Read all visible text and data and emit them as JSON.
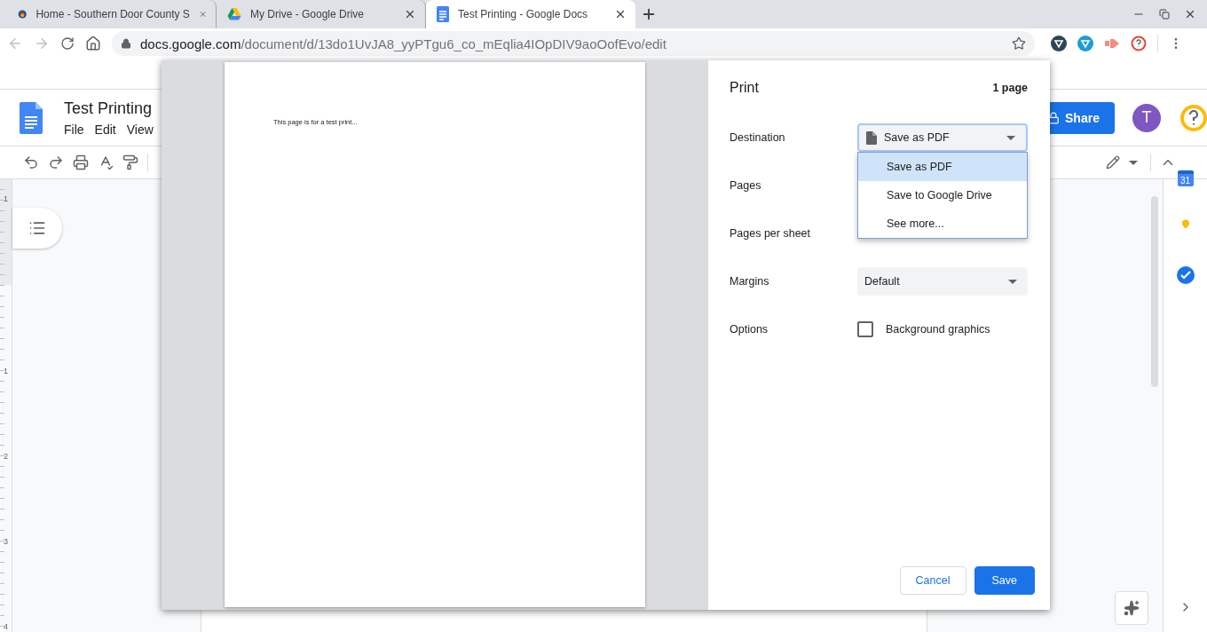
{
  "browser": {
    "tabs": [
      {
        "title": "Home - Southern Door County S",
        "selected": false
      },
      {
        "title": "My Drive - Google Drive",
        "selected": false
      },
      {
        "title": "Test Printing - Google Docs",
        "selected": true
      }
    ],
    "address": {
      "host": "docs.google.com",
      "path": "/document/d/13do1UvJA8_yyPTgu6_co_mEqlia4IOpDIV9aoOofEvo/edit"
    }
  },
  "doc": {
    "title": "Test Printing",
    "menus": [
      "File",
      "Edit",
      "View"
    ],
    "share": "Share",
    "avatar": "T",
    "calendar_day": "31",
    "ruler_numbers": [
      "1",
      "1",
      "2",
      "3",
      "4"
    ]
  },
  "print_dialog": {
    "title": "Print",
    "page_count": "1 page",
    "preview_text": "This page is for a test print...",
    "settings": [
      {
        "kind": "destination",
        "label": "Destination",
        "value": "Save as PDF",
        "focused": true
      },
      {
        "kind": "covered",
        "label": "Pages"
      },
      {
        "kind": "covered",
        "label": "Pages per sheet"
      },
      {
        "kind": "select",
        "label": "Margins",
        "value": "Default",
        "focused": false
      },
      {
        "kind": "checkbox",
        "label": "Options",
        "option": "Background graphics",
        "checked": false
      }
    ],
    "menu": [
      {
        "label": "Save as PDF",
        "selected": true
      },
      {
        "label": "Save to Google Drive",
        "selected": false
      },
      {
        "label": "See more...",
        "selected": false
      }
    ],
    "buttons": [
      {
        "label": "Cancel",
        "kind": "secondary"
      },
      {
        "label": "Save",
        "kind": "primary"
      }
    ]
  }
}
